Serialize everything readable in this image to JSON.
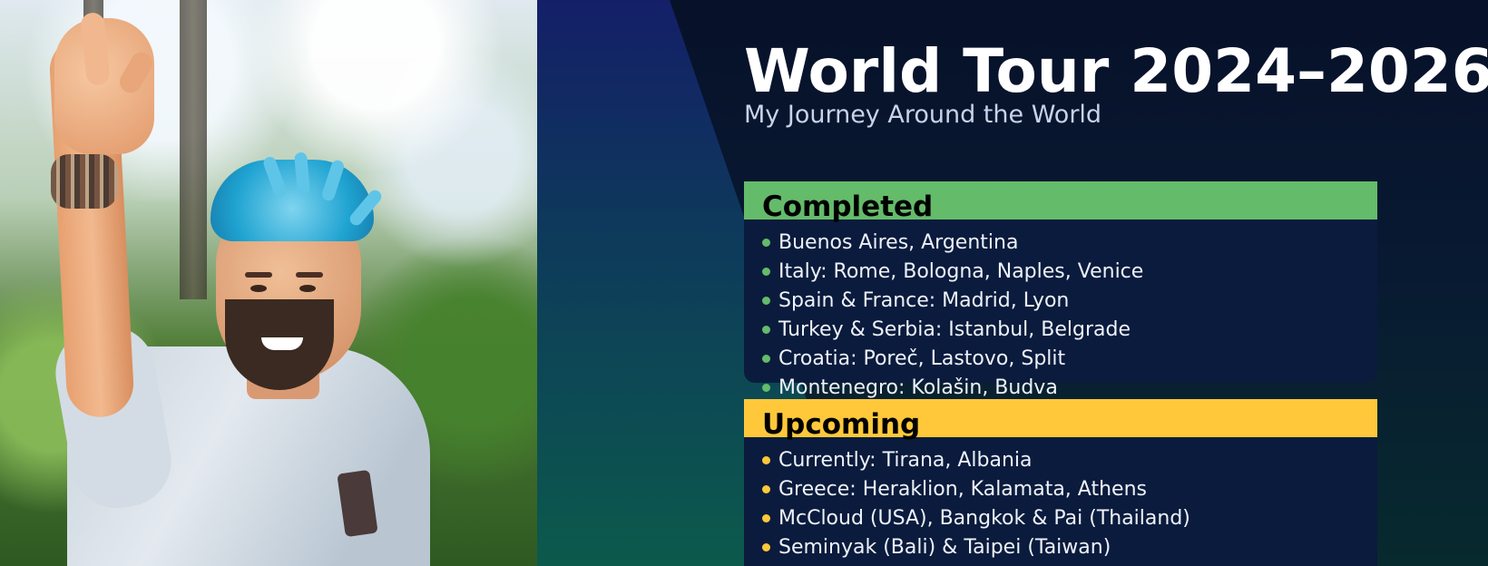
{
  "header": {
    "title": "World Tour 2024–2026",
    "subtitle": "My Journey Around the World"
  },
  "sections": {
    "completed": {
      "heading": "Completed",
      "color": "#64bb6a",
      "items": [
        "Buenos Aires, Argentina",
        "Italy: Rome, Bologna, Naples, Venice",
        "Spain & France: Madrid, Lyon",
        "Turkey & Serbia: Istanbul, Belgrade",
        "Croatia: Poreč, Lastovo, Split",
        "Montenegro: Kolašin, Budva"
      ]
    },
    "upcoming": {
      "heading": "Upcoming",
      "color": "#ffc83a",
      "items": [
        "Currently: Tirana, Albania",
        "Greece: Heraklion, Kalamata, Athens",
        "McCloud (USA), Bangkok & Pai (Thailand)",
        "Seminyak (Bali) & Taipei (Taiwan)"
      ]
    }
  },
  "colors": {
    "panel_top": "#071129",
    "beam_top": "#141f68",
    "beam_bottom": "#0c5a4c",
    "card": "#0b1b3d"
  }
}
